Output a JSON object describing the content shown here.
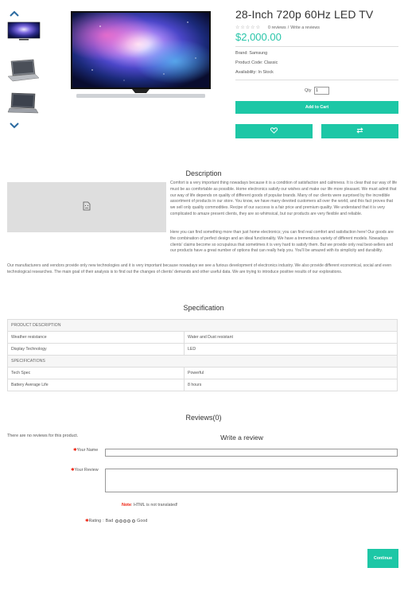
{
  "product": {
    "title": "28-Inch 720p 60Hz LED TV",
    "price": "$2,000.00",
    "reviews_link": "0 reviews",
    "write_review_link": "Write a reviews",
    "review_separator": "/",
    "rating_stars": 0,
    "brand": "Brand: Samsung",
    "product_code": "Product Code: Classic",
    "availability": "Availability: In Stock",
    "qty_label": "Qty",
    "qty_value": "1",
    "add_to_cart": "Add to Cart"
  },
  "thumbnails": {
    "up_icon": "chevron-up-icon",
    "down_icon": "chevron-down-icon",
    "items": [
      "tv-galaxy",
      "laptop-silver",
      "laptop-dark"
    ]
  },
  "description": {
    "title": "Description",
    "para1": "Comfort is a very important thing nowadays because it is a condition of satisfaction and calmness. It is clear that our way of life must be as comfortable as possible. Home electronics satisfy our wishes and make our life more pleasant. We must admit that our way of life depends on quality of different goods of popular brands. Many of our clients were surprised by the incredible assortment of products in our store. You know, we have many devoted customers all over the world, and this fact proves that we sell only quality commodities. Recipe of our success is a fair price and premium quality. We understand that it is very complicated to amaze present clients, they are so whimsical, but our products are very flexible and reliable.",
    "para2": "Here you can find something more than just home electronics; you can find real comfort and satisfaction here! Our goods are the combination of perfect design and an ideal functionality. We have a tremendous variety of different models. Nowadays clients' claims become so scrupulous that sometimes it is very hard to satisfy them. But we provide only real best-sellers and our products have a great number of options that can really help you. You'll be amazed with its simplicity and durability.",
    "para3": "Our manufacturers and vendors provide only new technologies and it is very important because nowadays we see a furious development of electronics industry. We also provide different economical, social and even technological researches. The main goal of their analysis is to find out the changes of clients' demands and other useful data. We are trying to introduce positive results of our explorations."
  },
  "specification": {
    "title": "Specification",
    "rows": [
      {
        "type": "head",
        "label": "PRODUCT DESCRIPTION"
      },
      {
        "type": "row",
        "name": "Weather resistance",
        "value": "Water and Dust resistant"
      },
      {
        "type": "row",
        "name": "Display Technology",
        "value": "LED"
      },
      {
        "type": "head",
        "label": "SPECIFICATIONS"
      },
      {
        "type": "row",
        "name": "Tech Spec",
        "value": "Powerful"
      },
      {
        "type": "row",
        "name": "Battery Average Life",
        "value": "8 hours"
      }
    ]
  },
  "reviews": {
    "title": "Reviews(0)",
    "none_text": "There are no reviews for this product.",
    "write_title": "Write a review",
    "name_label": "Your Name",
    "review_label": "Your Review",
    "note_label": "Note",
    "note_text": ": HTML is not translated!",
    "rating_label": "Rating",
    "bad_label": "Bad",
    "good_label": "Good",
    "continue": "Continue"
  },
  "colors": {
    "accent": "#1dc7a6",
    "price": "#29c5a9",
    "required": "#ee2211"
  }
}
